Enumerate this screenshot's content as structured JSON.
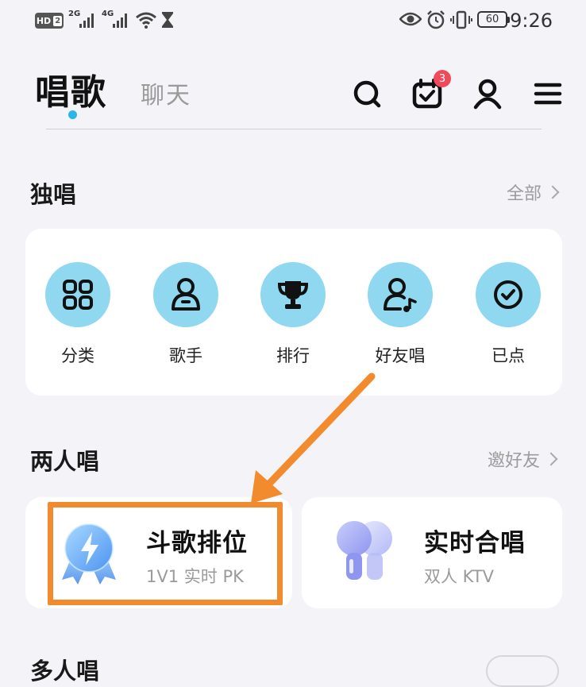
{
  "status_bar": {
    "hd_label": "HD",
    "sim2_label": "2",
    "net1": "2G",
    "net2": "4G",
    "battery": "60",
    "time": "9:26"
  },
  "nav": {
    "tabs": [
      {
        "label": "唱歌",
        "active": true
      },
      {
        "label": "聊天",
        "active": false
      }
    ],
    "icons": [
      "search-icon",
      "calendar-check-icon",
      "profile-icon",
      "menu-icon"
    ],
    "calendar_badge": "3"
  },
  "solo": {
    "title": "独唱",
    "link": "全部",
    "items": [
      {
        "label": "分类",
        "icon": "grid-icon"
      },
      {
        "label": "歌手",
        "icon": "singer-icon"
      },
      {
        "label": "排行",
        "icon": "trophy-icon"
      },
      {
        "label": "好友唱",
        "icon": "friend-sing-icon"
      },
      {
        "label": "已点",
        "icon": "check-circle-icon"
      }
    ]
  },
  "duet": {
    "title": "两人唱",
    "link": "邀好友",
    "cards": [
      {
        "title": "斗歌排位",
        "subtitle": "1V1 实时 PK",
        "icon": "medal-bolt-icon"
      },
      {
        "title": "实时合唱",
        "subtitle": "双人 KTV",
        "icon": "microphones-icon"
      }
    ]
  },
  "multi": {
    "title": "多人唱"
  },
  "colors": {
    "accent_dot": "#29b6e8",
    "icon_circle": "#8fd8f0",
    "annotation": "#f28a2e",
    "badge": "#ef4a5c"
  }
}
